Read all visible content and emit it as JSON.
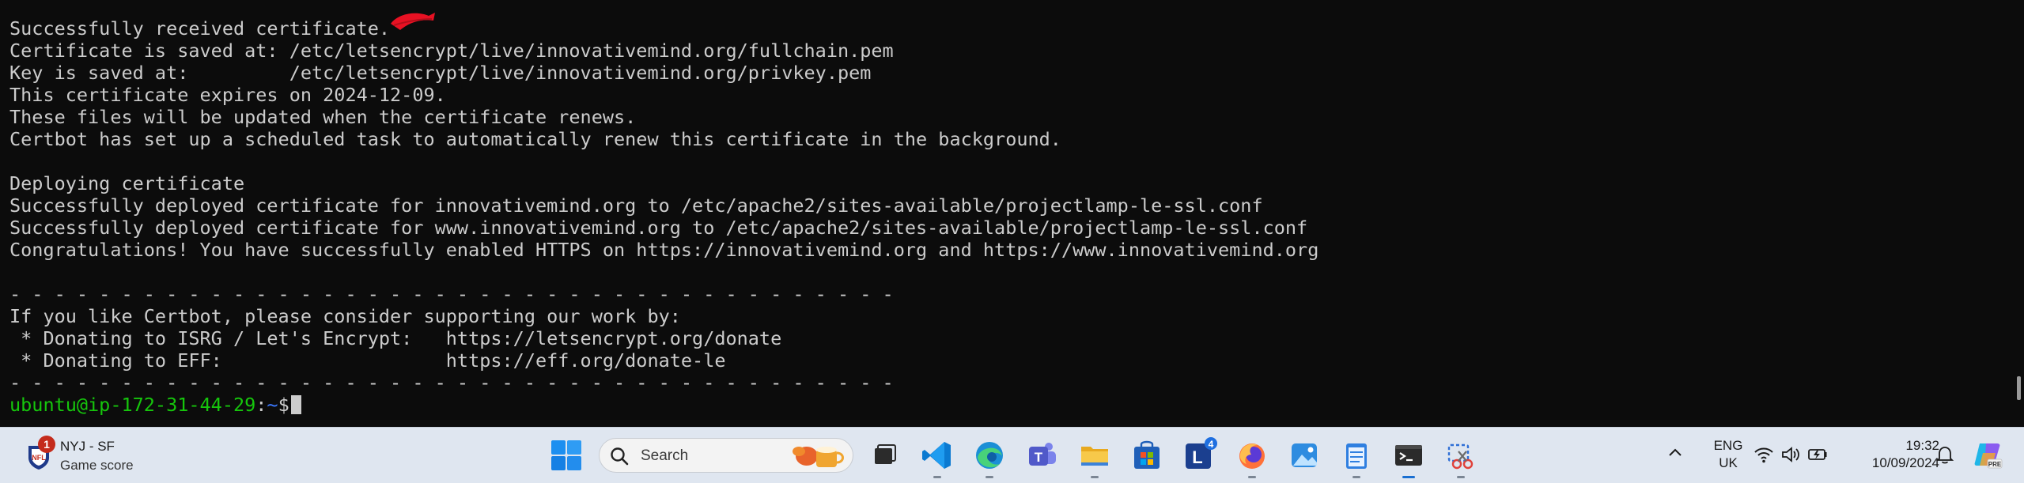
{
  "terminal": {
    "lines": [
      "Successfully received certificate.",
      "Certificate is saved at: /etc/letsencrypt/live/innovativemind.org/fullchain.pem",
      "Key is saved at:         /etc/letsencrypt/live/innovativemind.org/privkey.pem",
      "This certificate expires on 2024-12-09.",
      "These files will be updated when the certificate renews.",
      "Certbot has set up a scheduled task to automatically renew this certificate in the background.",
      "",
      "Deploying certificate",
      "Successfully deployed certificate for innovativemind.org to /etc/apache2/sites-available/projectlamp-le-ssl.conf",
      "Successfully deployed certificate for www.innovativemind.org to /etc/apache2/sites-available/projectlamp-le-ssl.conf",
      "Congratulations! You have successfully enabled HTTPS on https://innovativemind.org and https://www.innovativemind.org",
      "",
      "- - - - - - - - - - - - - - - - - - - - - - - - - - - - - - - - - - - - - - - -",
      "If you like Certbot, please consider supporting our work by:",
      " * Donating to ISRG / Let's Encrypt:   https://letsencrypt.org/donate",
      " * Donating to EFF:                    https://eff.org/donate-le",
      "- - - - - - - - - - - - - - - - - - - - - - - - - - - - - - - - - - - - - - - -"
    ],
    "prompt": {
      "user_host": "ubuntu@ip-172-31-44-29",
      "sep": ":",
      "path": "~",
      "dollar": "$"
    },
    "colors": {
      "background": "#0c0c0c",
      "text": "#cccccc",
      "prompt_user": "#16c60c",
      "prompt_path": "#3b78ff",
      "annotation": "#e81123"
    }
  },
  "taskbar": {
    "widget": {
      "badge": "1",
      "title": "NYJ - SF",
      "subtitle": "Game score",
      "icon": "nfl-shield-icon"
    },
    "search": {
      "placeholder": "Search"
    },
    "apps": [
      {
        "name": "task-view-icon"
      },
      {
        "name": "vscode-icon"
      },
      {
        "name": "edge-icon"
      },
      {
        "name": "teams-icon"
      },
      {
        "name": "file-explorer-icon"
      },
      {
        "name": "microsoft-store-icon"
      },
      {
        "name": "l-app-icon",
        "badge": "4"
      },
      {
        "name": "firefox-icon"
      },
      {
        "name": "photos-icon"
      },
      {
        "name": "notepad-icon"
      },
      {
        "name": "terminal-icon"
      },
      {
        "name": "snipping-tool-icon"
      }
    ],
    "tray": {
      "lang_line1": "ENG",
      "lang_line2": "UK",
      "time": "19:32",
      "date": "10/09/2024"
    }
  }
}
